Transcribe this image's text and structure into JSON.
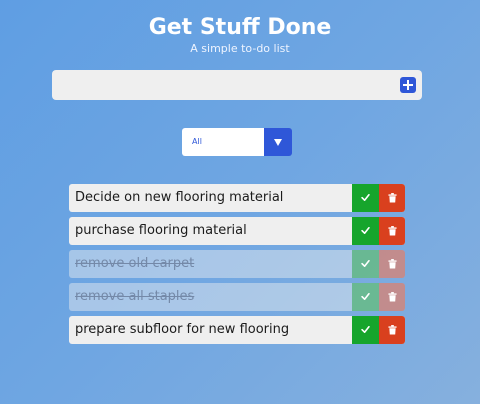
{
  "header": {
    "title": "Get Stuff Done",
    "subtitle": "A simple to-do list"
  },
  "add_item": {
    "value": "",
    "placeholder": "",
    "button_icon": "plus-icon"
  },
  "filter": {
    "selected": "All",
    "icon": "dropdown-arrow-icon"
  },
  "todos": [
    {
      "text": "Decide on new flooring material",
      "completed": false
    },
    {
      "text": "purchase flooring material",
      "completed": false
    },
    {
      "text": "remove old carpet",
      "completed": true
    },
    {
      "text": "remove all staples",
      "completed": true
    },
    {
      "text": "prepare subfloor for new flooring",
      "completed": false
    }
  ],
  "colors": {
    "accent": "#2f57d8",
    "complete": "#16a52c",
    "remove": "#d9401e",
    "item_background": "#efefef"
  }
}
